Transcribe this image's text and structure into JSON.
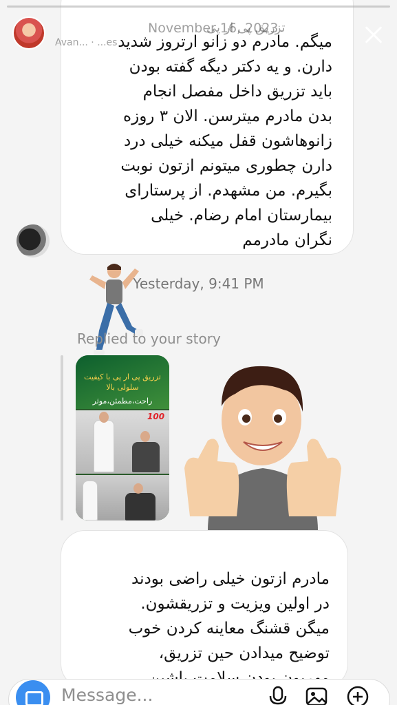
{
  "header": {
    "date": "November 16, 2023",
    "name": "تزریق پی ار پی",
    "subtitle": "Avan... · ...es"
  },
  "thread": {
    "bubble1_lines": [
      "میگم. مادرم دو زانو ارتروز شدید",
      "دارن. و یه دکتر دیگه گفته بودن",
      "باید تزریق داخل مفصل انجام",
      "بدن مادرم میترسن. الان ۳ روزه",
      "زانوهاشون قفل میکنه خیلی درد",
      "دارن چطوری میتونم ازتون نوبت",
      "بگیرم. من مشهدم. از پرستارای",
      "بیمارستان امام رضام. خیلی",
      "نگران مادرمم"
    ],
    "timestamp": "Yesterday, 9:41 PM",
    "replied_label": "Replied to your story",
    "story_thumb": {
      "headline": "تزریق پی ار پی با کیفیت",
      "headline2": "سلولی بالا",
      "tagline": "راحت،مطمئن،موثر",
      "badge": "100"
    },
    "bubble2_lines": [
      "مادرم ازتون خیلی راضی بودند",
      "در اولین ویزیت و تزریقشون.",
      "میگن قشنگ معاینه کردن خوب",
      "توضیح میدادن حین تزریق،",
      "مهربون بودن.سلامت باشین"
    ]
  },
  "composer": {
    "placeholder": "Message...",
    "icons": [
      "camera-icon",
      "microphone-icon",
      "gallery-icon",
      "add-icon"
    ]
  },
  "colors": {
    "accent": "#3a8ef0",
    "background": "#f4f4f4",
    "bubble": "#ffffff"
  }
}
